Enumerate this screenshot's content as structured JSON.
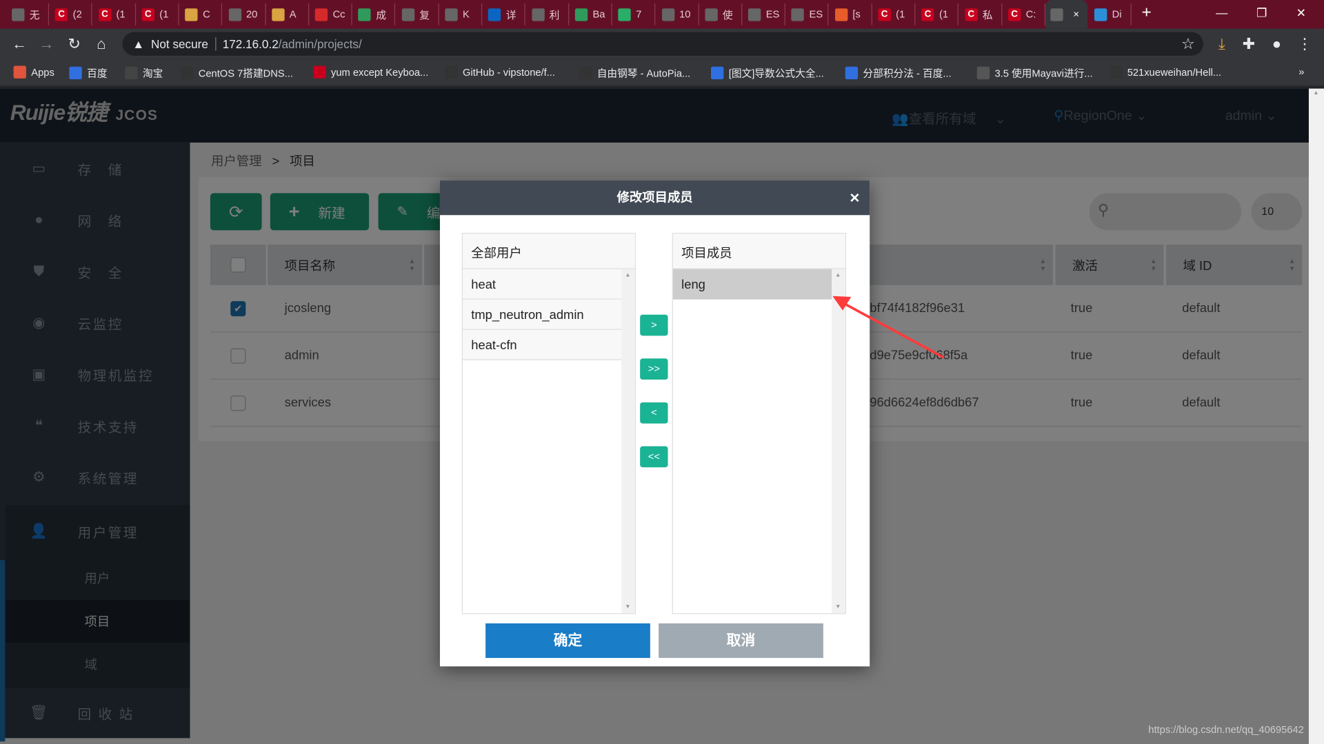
{
  "browser": {
    "tabs": [
      {
        "label": "无",
        "icon": "globe-icon"
      },
      {
        "label": "(2",
        "icon": "csdn-icon"
      },
      {
        "label": "(1",
        "icon": "csdn-icon"
      },
      {
        "label": "(1",
        "icon": "csdn-icon"
      },
      {
        "label": "C",
        "icon": "avatar-icon"
      },
      {
        "label": "20",
        "icon": "globe-icon"
      },
      {
        "label": "A",
        "icon": "avatar-icon"
      },
      {
        "label": "Cc",
        "icon": "five-icon"
      },
      {
        "label": "成",
        "icon": "bars-icon"
      },
      {
        "label": "复",
        "icon": "leaf-icon"
      },
      {
        "label": "K",
        "icon": "swirl-icon"
      },
      {
        "label": "详",
        "icon": "zhihu-icon"
      },
      {
        "label": "利",
        "icon": "swirl-icon"
      },
      {
        "label": "Ba",
        "icon": "bars-icon"
      },
      {
        "label": "7",
        "icon": "wechat-icon"
      },
      {
        "label": "10",
        "icon": "flask-icon"
      },
      {
        "label": "使",
        "icon": "husky-icon"
      },
      {
        "label": "ES",
        "icon": "swirl-icon"
      },
      {
        "label": "ES",
        "icon": "globe-icon"
      },
      {
        "label": "[s",
        "icon": "shield-icon"
      },
      {
        "label": "(1",
        "icon": "csdn-icon"
      },
      {
        "label": "(1",
        "icon": "csdn-icon"
      },
      {
        "label": "私",
        "icon": "csdn-icon"
      },
      {
        "label": "C:",
        "icon": "csdn-icon"
      },
      {
        "label": "",
        "icon": "pulse-icon",
        "active": true
      },
      {
        "label": "Di",
        "icon": "bilibili-icon"
      }
    ],
    "security": "Not secure",
    "url_host": "172.16.0.2",
    "url_path": "/admin/projects/",
    "bookmarks": [
      "Apps",
      "百度",
      "淘宝",
      "CentOS 7搭建DNS...",
      "yum except Keyboa...",
      "GitHub - vipstone/f...",
      "自由钢琴 - AutoPia...",
      "[图文]导数公式大全...",
      "分部积分法 - 百度...",
      "3.5 使用Mayavi进行...",
      "521xueweihan/Hell..."
    ],
    "more": "»"
  },
  "header": {
    "logo": "Ruijie锐捷",
    "product": "JCOS",
    "domain_select": "查看所有域",
    "region": "RegionOne",
    "user": "admin"
  },
  "sidebar": {
    "items": [
      {
        "label": "存　储",
        "icon": "storage-icon"
      },
      {
        "label": "网　络",
        "icon": "globe-icon"
      },
      {
        "label": "安　全",
        "icon": "shield-icon"
      },
      {
        "label": "云监控",
        "icon": "eye-icon"
      },
      {
        "label": "物理机监控",
        "icon": "camera-icon"
      },
      {
        "label": "技术支持",
        "icon": "chat-icon"
      },
      {
        "label": "系统管理",
        "icon": "gears-icon"
      },
      {
        "label": "用户管理",
        "icon": "user-icon"
      }
    ],
    "sub": [
      "用户",
      "项目",
      "域"
    ],
    "recycle": "回 收 站"
  },
  "breadcrumb": {
    "parent": "用户管理",
    "sep": ">",
    "current": "项目"
  },
  "toolbar": {
    "create": "新建",
    "edit": "编辑",
    "page_size": "10"
  },
  "table": {
    "columns": [
      "项目名称",
      "激活",
      "域 ID"
    ],
    "rows": [
      {
        "name": "jcosleng",
        "id": "bf74f4182f96e31",
        "active": "true",
        "domain": "default",
        "checked": true
      },
      {
        "name": "admin",
        "id": "d9e75e9cf068f5a",
        "active": "true",
        "domain": "default",
        "checked": false
      },
      {
        "name": "services",
        "id": "96d6624ef8d6db67",
        "active": "true",
        "domain": "default",
        "checked": false
      }
    ]
  },
  "modal": {
    "title": "修改项目成员",
    "close": "×",
    "left_title": "全部用户",
    "left_items": [
      "heat",
      "tmp_neutron_admin",
      "heat-cfn"
    ],
    "right_title": "项目成员",
    "right_items": [
      "leng"
    ],
    "move": [
      ">",
      ">>",
      "<",
      "<<"
    ],
    "ok": "确定",
    "cancel": "取消"
  },
  "watermark": "https://blog.csdn.net/qq_40695642",
  "colors": {
    "accent_green": "#1ab394",
    "confirm_blue": "#1a7dc7",
    "annotation_arrow": "#ff3b3b"
  }
}
